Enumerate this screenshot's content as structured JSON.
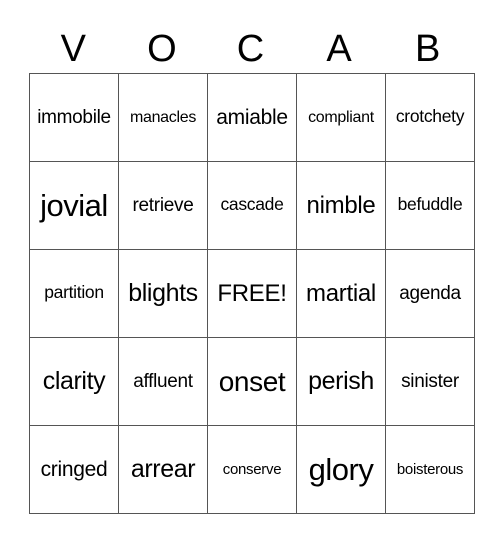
{
  "card": {
    "header": [
      "V",
      "O",
      "C",
      "A",
      "B"
    ],
    "rows": [
      [
        "immobile",
        "manacles",
        "amiable",
        "compliant",
        "crotchety"
      ],
      [
        "jovial",
        "retrieve",
        "cascade",
        "nimble",
        "befuddle"
      ],
      [
        "partition",
        "blights",
        "FREE!",
        "martial",
        "agenda"
      ],
      [
        "clarity",
        "affluent",
        "onset",
        "perish",
        "sinister"
      ],
      [
        "cringed",
        "arrear",
        "conserve",
        "glory",
        "boisterous"
      ]
    ]
  }
}
